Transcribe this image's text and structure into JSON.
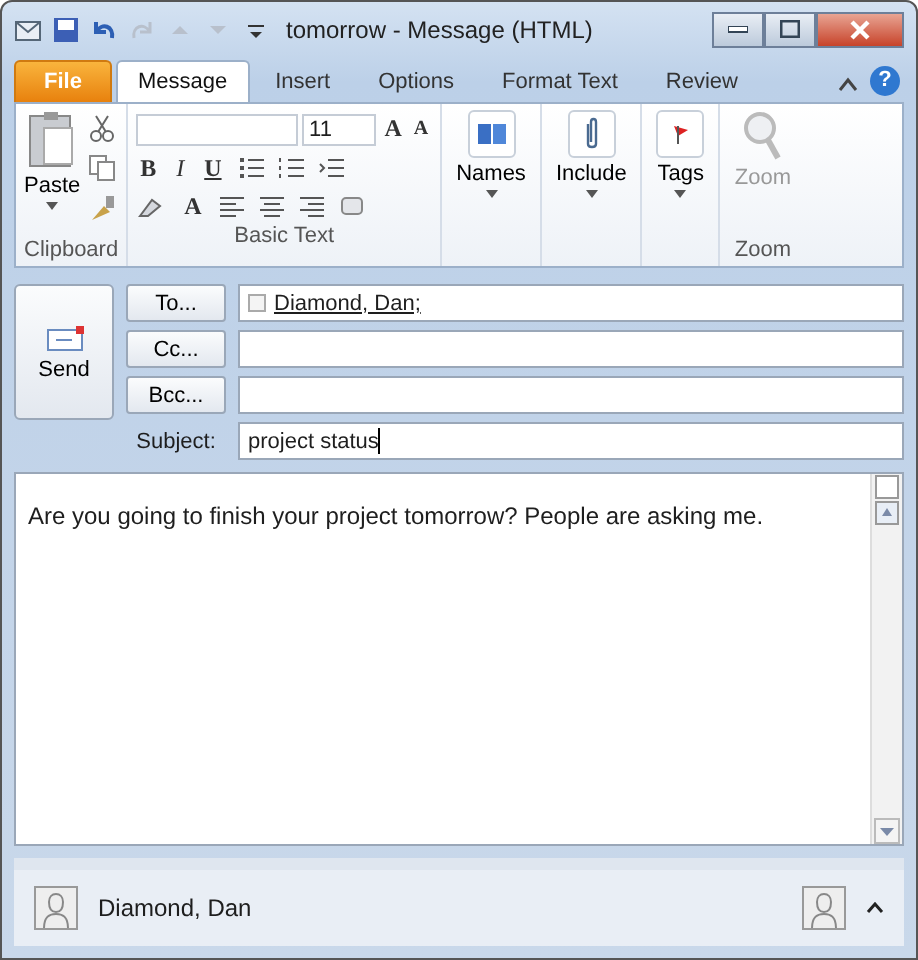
{
  "window": {
    "title": "tomorrow - Message (HTML)"
  },
  "tabs": [
    {
      "label": "File",
      "kind": "file",
      "selected": false
    },
    {
      "label": "Message",
      "kind": "tab",
      "selected": true
    },
    {
      "label": "Insert",
      "kind": "tab",
      "selected": false
    },
    {
      "label": "Options",
      "kind": "tab",
      "selected": false
    },
    {
      "label": "Format Text",
      "kind": "tab",
      "selected": false
    },
    {
      "label": "Review",
      "kind": "tab",
      "selected": false
    }
  ],
  "help": "?",
  "ribbon": {
    "clipboard": {
      "paste": "Paste",
      "label": "Clipboard"
    },
    "basic_text": {
      "font_size": "11",
      "bold": "B",
      "italic": "I",
      "underline": "U",
      "grow": "A",
      "shrink": "A",
      "font_color": "A",
      "label": "Basic Text"
    },
    "large_buttons": [
      {
        "label": "Names"
      },
      {
        "label": "Include"
      },
      {
        "label": "Tags"
      }
    ],
    "zoom": {
      "button": "Zoom",
      "label": "Zoom",
      "disabled": true
    }
  },
  "compose": {
    "send": "Send",
    "address_rows": [
      {
        "button": "To...",
        "value": "Diamond, Dan;"
      },
      {
        "button": "Cc..."
      },
      {
        "button": "Bcc..."
      }
    ],
    "subject": {
      "label": "Subject:",
      "value": "project status"
    },
    "body": "Are you going to finish your project tomorrow? People are asking me."
  },
  "people_pane": {
    "name": "Diamond, Dan"
  }
}
